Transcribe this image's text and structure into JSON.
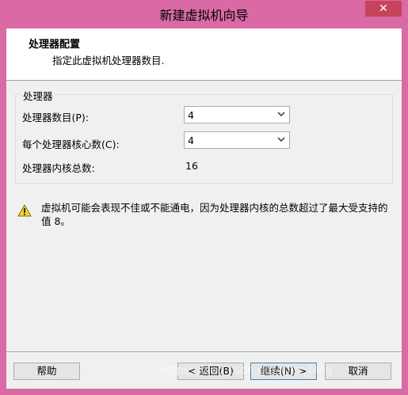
{
  "window": {
    "title": "新建虚拟机向导",
    "close_glyph": "✕"
  },
  "header": {
    "title": "处理器配置",
    "subtitle": "指定此虚拟机处理器数目."
  },
  "group": {
    "legend": "处理器",
    "rows": [
      {
        "label": "处理器数目(P):",
        "value": "4"
      },
      {
        "label": "每个处理器核心数(C):",
        "value": "4"
      },
      {
        "label": "处理器内核总数:",
        "value": "16"
      }
    ]
  },
  "warning": {
    "icon": "warning-icon",
    "text": "虚拟机可能会表现不佳或不能通电，因为处理器内核的总数超过了最大受支持的值 8。"
  },
  "buttons": {
    "help": "帮助",
    "back": "< 返回(B)",
    "next": "继续(N) >",
    "cancel": "取消"
  },
  "watermark": "https://blog.csdn.net/mez_blog",
  "colors": {
    "frame": "#d96aa5",
    "close": "#c7445a",
    "warning": "#f5d230"
  }
}
